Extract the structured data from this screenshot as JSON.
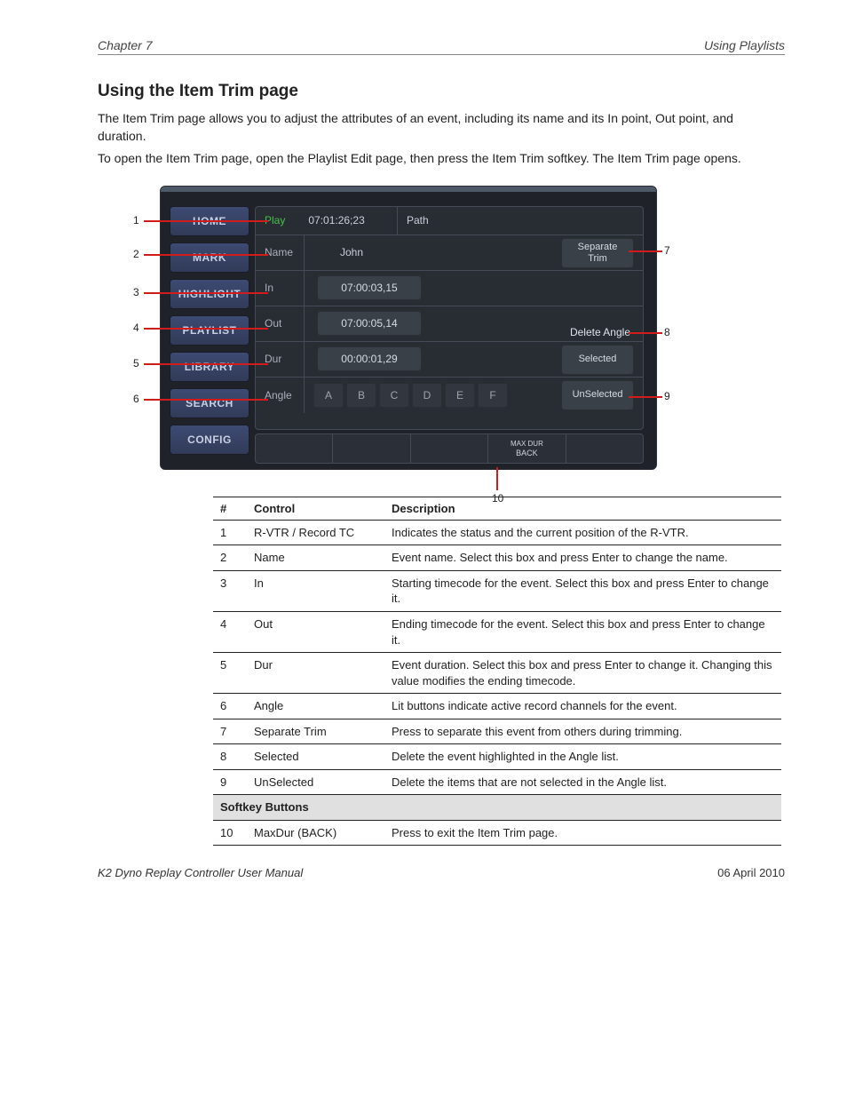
{
  "header": {
    "left": "Chapter 7",
    "right": "Using Playlists"
  },
  "section_title": "Using the Item Trim page",
  "intro_p1": "The Item Trim page allows you to adjust the attributes of an event, including its name and its In point, Out point, and duration.",
  "intro_p2": "To open the Item Trim page, open the Playlist Edit page, then press the Item Trim softkey. The Item Trim page opens.",
  "sidebar": [
    "HOME",
    "MARK",
    "HIGHLIGHT",
    "PLAYLIST",
    "LIBRARY",
    "SEARCH",
    "CONFIG"
  ],
  "panel": {
    "play_label": "Play",
    "play_tc": "07:01:26;23",
    "path_label": "Path",
    "name_label": "Name",
    "name_value": "John",
    "in_label": "In",
    "in_value": "07:00:03,15",
    "out_label": "Out",
    "out_value": "07:00:05,14",
    "dur_label": "Dur",
    "dur_value": "00:00:01,29",
    "angle_label": "Angle",
    "angles": [
      "A",
      "B",
      "C",
      "D",
      "E",
      "F"
    ],
    "separate_trim": "Separate\nTrim",
    "delete_angle_label": "Delete Angle",
    "selected": "Selected",
    "unselected": "UnSelected"
  },
  "softkeys": {
    "maxdur_top": "MAX DUR",
    "maxdur_bot": "BACK"
  },
  "callouts": {
    "c1": "1",
    "c2": "2",
    "c3": "3",
    "c4": "4",
    "c5": "5",
    "c6": "6",
    "c7": "7",
    "c8": "8",
    "c9": "9",
    "c10": "10"
  },
  "table": {
    "head": {
      "num": "#",
      "control": "Control",
      "desc": "Description"
    },
    "rows": [
      {
        "n": "1",
        "ctrl": "R-VTR / Record TC",
        "desc": "Indicates the status and the current position of the R-VTR."
      },
      {
        "n": "2",
        "ctrl": "Name",
        "desc": "Event name. Select this box and press Enter to change the name."
      },
      {
        "n": "3",
        "ctrl": "In",
        "desc": "Starting timecode for the event. Select this box and press Enter to change it."
      },
      {
        "n": "4",
        "ctrl": "Out",
        "desc": "Ending timecode for the event. Select this box and press Enter to change it."
      },
      {
        "n": "5",
        "ctrl": "Dur",
        "desc": "Event duration. Select this box and press Enter to change it. Changing this value modifies the ending timecode."
      },
      {
        "n": "6",
        "ctrl": "Angle",
        "desc": "Lit buttons indicate active record channels for the event."
      },
      {
        "n": "7",
        "ctrl": "Separate Trim",
        "desc": "Press to separate this event from others during trimming."
      },
      {
        "n": "8",
        "ctrl": "Selected",
        "desc": "Delete the event highlighted in the Angle list."
      },
      {
        "n": "9",
        "ctrl": "UnSelected",
        "desc": "Delete the items that are not selected in the Angle list."
      }
    ],
    "softkey_head": "Softkey Buttons",
    "softkey_rows": [
      {
        "n": "10",
        "ctrl": "MaxDur (BACK)",
        "desc": "Press to exit the Item Trim page."
      }
    ]
  },
  "footer": {
    "left": "K2 Dyno Replay Controller User Manual",
    "right": "06 April 2010"
  }
}
